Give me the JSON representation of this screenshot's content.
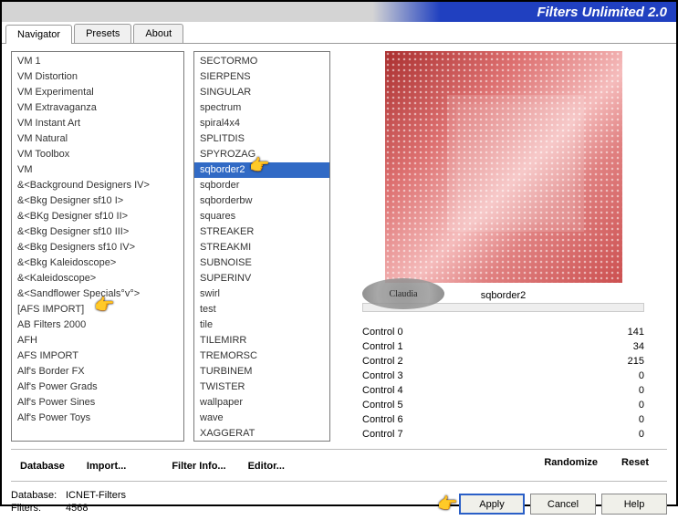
{
  "title": "Filters Unlimited 2.0",
  "tabs": [
    "Navigator",
    "Presets",
    "About"
  ],
  "active_tab": 0,
  "categories": [
    "VM 1",
    "VM Distortion",
    "VM Experimental",
    "VM Extravaganza",
    "VM Instant Art",
    "VM Natural",
    "VM Toolbox",
    "VM",
    "&<Background Designers IV>",
    "&<Bkg Designer sf10 I>",
    "&<BKg Designer sf10 II>",
    "&<Bkg Designer sf10 III>",
    "&<Bkg Designers sf10 IV>",
    "&<Bkg Kaleidoscope>",
    "&<Kaleidoscope>",
    "&<Sandflower Specials°v°>",
    "[AFS IMPORT]",
    "AB Filters 2000",
    "AFH",
    "AFS IMPORT",
    "Alf's Border FX",
    "Alf's Power Grads",
    "Alf's Power Sines",
    "Alf's Power Toys"
  ],
  "category_selected": 16,
  "filters": [
    "SECTORMO",
    "SIERPENS",
    "SINGULAR",
    "spectrum",
    "spiral4x4",
    "SPLITDIS",
    "SPYROZAG",
    "sqborder2",
    "sqborder",
    "sqborderbw",
    "squares",
    "STREAKER",
    "STREAKMI",
    "SUBNOISE",
    "SUPERINV",
    "swirl",
    "test",
    "tile",
    "TILEMIRR",
    "TREMORSC",
    "TURBINEM",
    "TWISTER",
    "wallpaper",
    "wave",
    "XAGGERAT"
  ],
  "filter_selected": 7,
  "preview_label": "sqborder2",
  "controls": [
    {
      "label": "Control 0",
      "value": 141
    },
    {
      "label": "Control 1",
      "value": 34
    },
    {
      "label": "Control 2",
      "value": 215
    },
    {
      "label": "Control 3",
      "value": 0
    },
    {
      "label": "Control 4",
      "value": 0
    },
    {
      "label": "Control 5",
      "value": 0
    },
    {
      "label": "Control 6",
      "value": 0
    },
    {
      "label": "Control 7",
      "value": 0
    }
  ],
  "toolbar": {
    "database": "Database",
    "import": "Import...",
    "filter_info": "Filter Info...",
    "editor": "Editor...",
    "randomize": "Randomize",
    "reset": "Reset"
  },
  "status": {
    "db_label": "Database:",
    "db_value": "ICNET-Filters",
    "filters_label": "Filters:",
    "filters_value": "4568"
  },
  "buttons": {
    "apply": "Apply",
    "cancel": "Cancel",
    "help": "Help"
  },
  "watermark": "Claudia"
}
